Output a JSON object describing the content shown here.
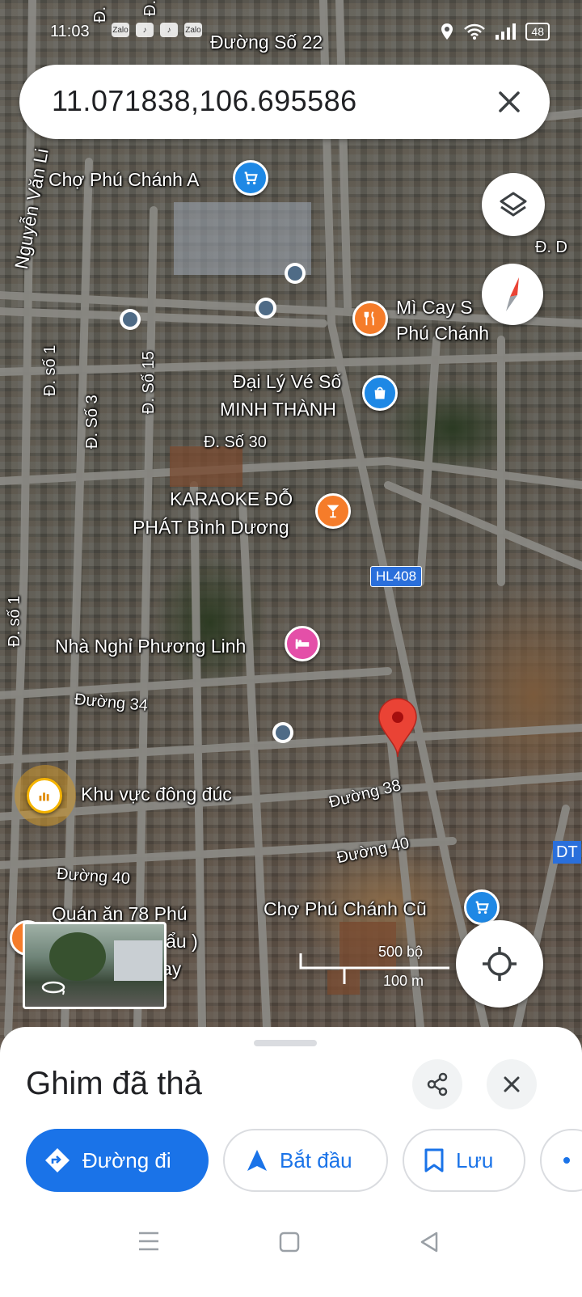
{
  "status_bar": {
    "time": "11:03",
    "app_icons": [
      "Zalo",
      "TikTok",
      "TikTok",
      "Zalo"
    ],
    "battery": "48"
  },
  "search": {
    "query": "11.071838,106.695586"
  },
  "map": {
    "streets": [
      "Đường Số 22",
      "Nguyễn Văn Li",
      "Đ. số 1",
      "Đ. Số 3",
      "Đ. Số 15",
      "Đ. Số 30",
      "Đ. số 1",
      "Đường 34",
      "Đường 38",
      "Đường 40",
      "Đường 40",
      "Đ. D",
      "DT",
      "Đ.",
      "Đ."
    ],
    "road_shield": "HL408",
    "places": {
      "cho_phu_chanh_a": "Chợ Phú Chánh A",
      "mi_cay_line1": "Mì Cay S",
      "mi_cay_line2": "Phú Chánh",
      "dai_ly_line1": "Đại Lý Vé Số",
      "dai_ly_line2": "MINH THÀNH",
      "karaoke_line1": "KARAOKE ĐỖ",
      "karaoke_line2": "PHÁT Bình Dương",
      "nha_nghi": "Nhà Nghỉ Phương Linh",
      "khu_vuc": "Khu vực đông đúc",
      "cho_phu_chanh_cu": "Chợ Phú Chánh Cũ",
      "quan_an_line1": "Quán ăn 78 Phú",
      "quan_an_line2": "lẩu )",
      "quan_an_line3": "ay"
    },
    "scale": {
      "imperial": "500 bộ",
      "metric": "100 m"
    }
  },
  "bottom_sheet": {
    "title": "Ghim đã thả",
    "actions": {
      "directions": "Đường đi",
      "start": "Bắt đầu",
      "save": "Lưu"
    }
  },
  "colors": {
    "accent": "#1a73e8",
    "pin": "#ea4335",
    "poi_orange": "#f57c2a",
    "poi_blue": "#1e88e5",
    "poi_pink": "#e44fa8"
  }
}
